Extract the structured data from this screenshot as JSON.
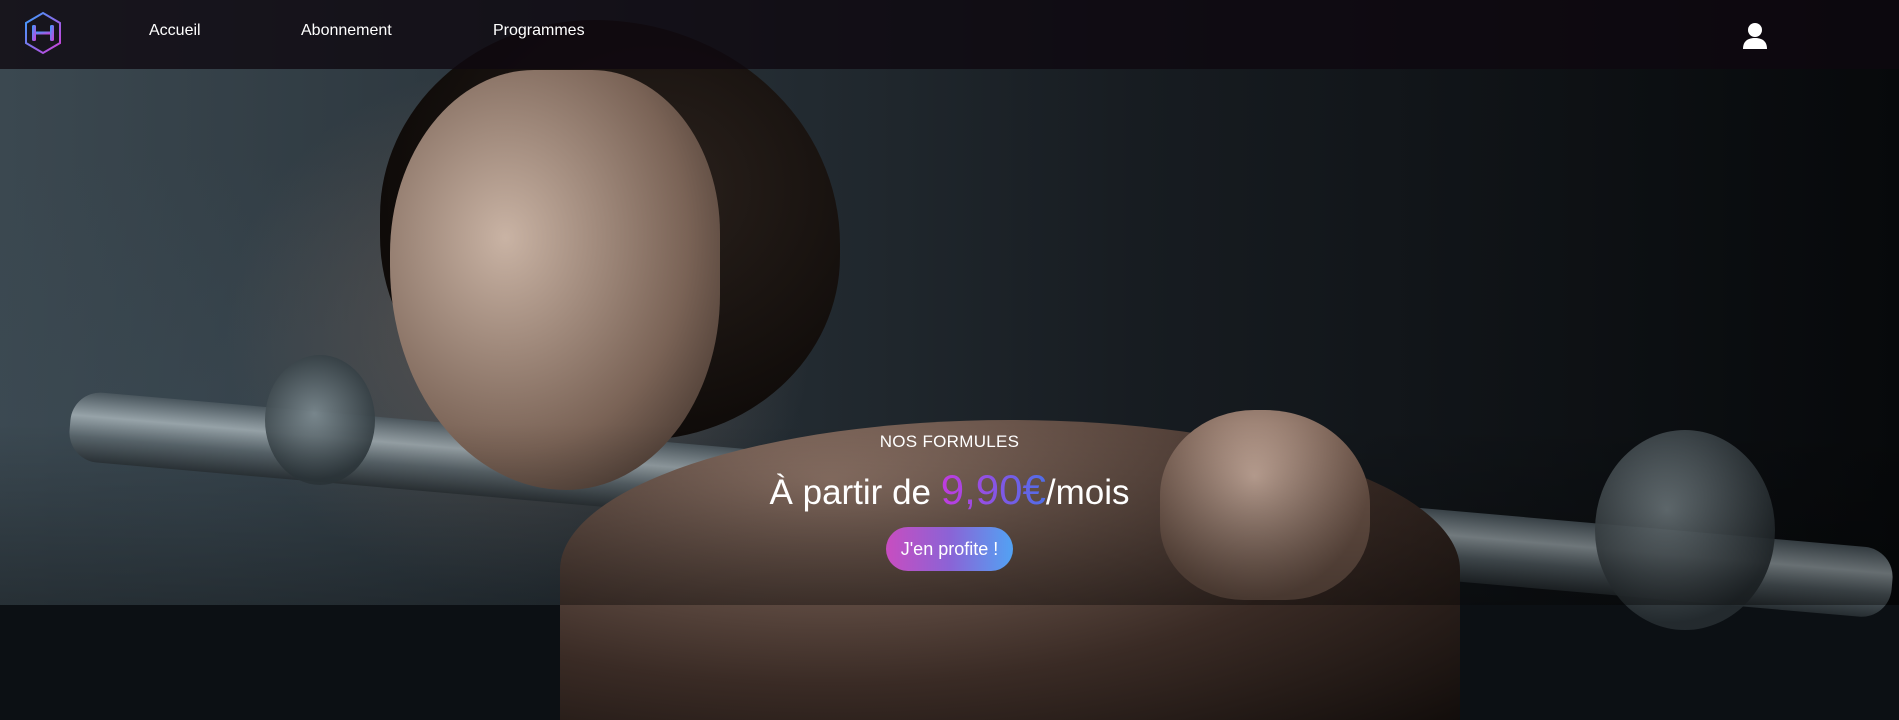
{
  "nav": {
    "logo_icon": "dumbbell-hexagon-logo",
    "links": [
      "Accueil",
      "Abonnement",
      "Programmes"
    ],
    "user_icon": "user-icon"
  },
  "promo": {
    "eyebrow": "NOS FORMULES",
    "prefix": "À partir de",
    "price": "9,90€",
    "suffix": "/mois",
    "cta": "J'en profite !"
  },
  "colors": {
    "gradient_start": "#c84dc0",
    "gradient_end": "#52a2f3"
  }
}
